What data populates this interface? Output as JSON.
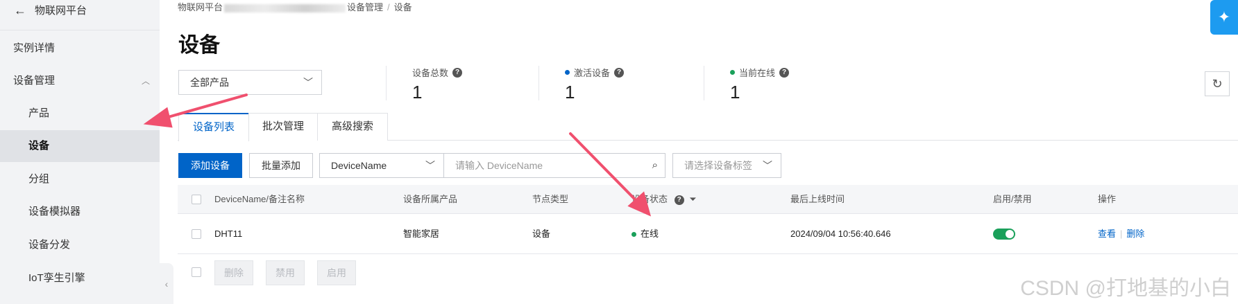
{
  "sidebar": {
    "back_icon": "arrow-left-icon",
    "platform_title": "物联网平台",
    "items": [
      {
        "label": "实例详情"
      },
      {
        "label": "设备管理"
      },
      {
        "label": "产品"
      },
      {
        "label": "设备"
      },
      {
        "label": "分组"
      },
      {
        "label": "设备模拟器"
      },
      {
        "label": "设备分发"
      },
      {
        "label": "IoT孪生引擎"
      }
    ],
    "collapse_icon": "‹"
  },
  "breadcrumb": {
    "root": "物联网平台",
    "middle": "设备管理",
    "current": "设备"
  },
  "page_title": "设备",
  "product_select": {
    "value": "全部产品"
  },
  "stats": [
    {
      "label": "设备总数",
      "value": "1",
      "dot_color": ""
    },
    {
      "label": "激活设备",
      "value": "1",
      "dot_color": "#0064c8"
    },
    {
      "label": "当前在线",
      "value": "1",
      "dot_color": "#1aa05a"
    }
  ],
  "tabs": [
    {
      "label": "设备列表"
    },
    {
      "label": "批次管理"
    },
    {
      "label": "高级搜索"
    }
  ],
  "toolbar": {
    "add_device": "添加设备",
    "batch_add": "批量添加",
    "search_field_select": "DeviceName",
    "search_placeholder": "请输入 DeviceName",
    "tag_placeholder": "请选择设备标签"
  },
  "table": {
    "headers": [
      "DeviceName/备注名称",
      "设备所属产品",
      "节点类型",
      "设备状态",
      "最后上线时间",
      "启用/禁用",
      "操作"
    ],
    "rows": [
      {
        "device_name": "DHT11",
        "product": "智能家居",
        "node_type": "设备",
        "status": "在线",
        "last_online": "2024/09/04 10:56:40.646",
        "enabled": true,
        "actions": [
          "查看",
          "删除"
        ]
      }
    ]
  },
  "bulk_actions": [
    "删除",
    "禁用",
    "启用"
  ],
  "colors": {
    "primary": "#0064c8",
    "online": "#1aa05a",
    "annotation_arrow": "#f0506e"
  },
  "watermark": "CSDN @打地基的小白"
}
